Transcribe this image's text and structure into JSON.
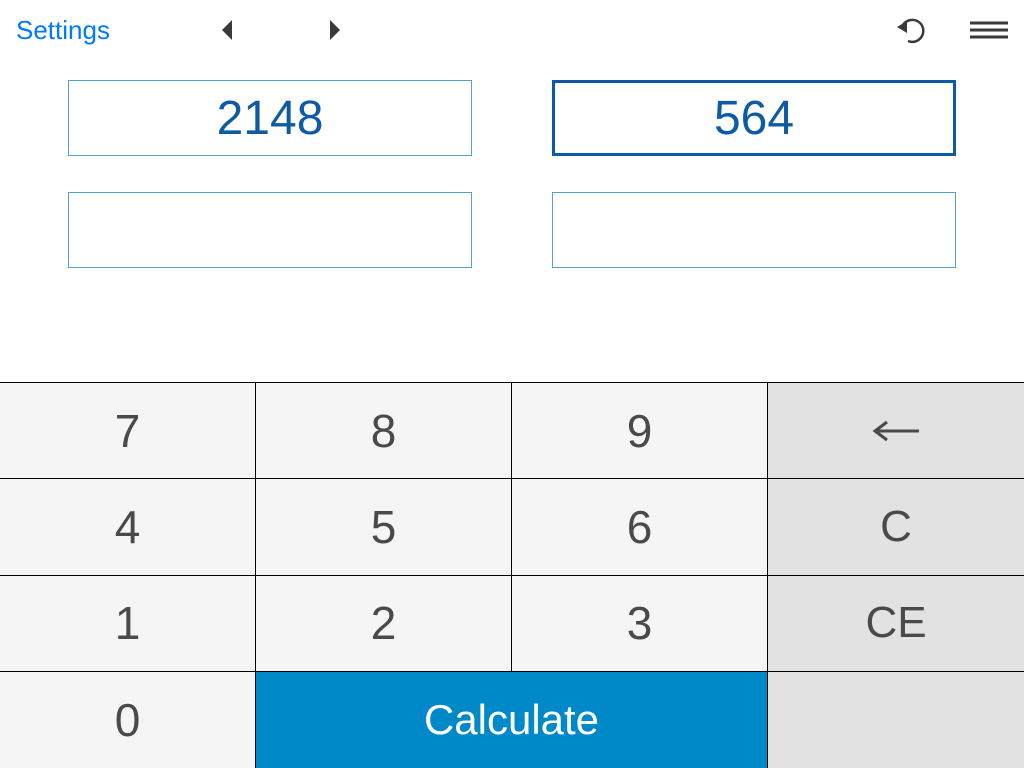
{
  "header": {
    "settings_label": "Settings"
  },
  "fields": {
    "left_top": "2148",
    "right_top": "564",
    "left_bottom": "",
    "right_bottom": ""
  },
  "keypad": {
    "k7": "7",
    "k8": "8",
    "k9": "9",
    "k4": "4",
    "k5": "5",
    "k6": "6",
    "k1": "1",
    "k2": "2",
    "k3": "3",
    "k0": "0",
    "c": "C",
    "ce": "CE",
    "calc": "Calculate"
  }
}
